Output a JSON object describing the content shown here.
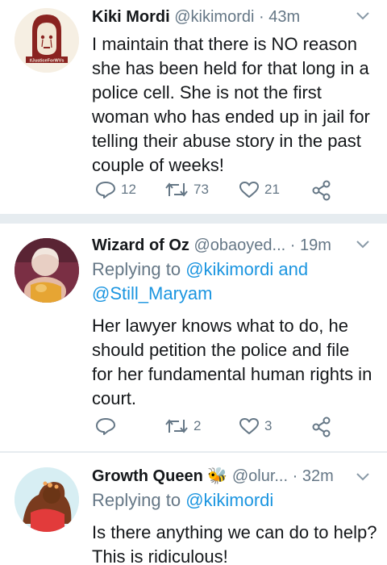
{
  "tweets": [
    {
      "name": "Kiki Mordi",
      "handle": "@kikimordi",
      "dot": "·",
      "time": "43m",
      "replying_prefix": "",
      "replying_mentions": "",
      "body_lines": [
        "I maintain that there is NO reason",
        "she has been held for that long in a",
        "police cell. She is not the first",
        "woman who has ended up in jail for",
        "telling their abuse story in the past",
        "couple of weeks!"
      ],
      "avatar_text": "#JusticeForWVs",
      "replies": "12",
      "retweets": "73",
      "likes": "21"
    },
    {
      "name": "Wizard of Oz",
      "handle": "@obaoyed...",
      "dot": "·",
      "time": "19m",
      "replying_lines": [
        "Replying to ",
        "@kikimordi and",
        "@Still_Maryam"
      ],
      "body_lines": [
        "Her lawyer knows what to do, he",
        "should petition the police and file",
        "for her fundamental human rights in",
        "court."
      ],
      "replies": "",
      "retweets": "2",
      "likes": "3"
    },
    {
      "name": "Growth Queen",
      "badge": "🐝",
      "handle": "@olur...",
      "dot": "·",
      "time": "32m",
      "replying_prefix": "Replying to ",
      "replying_mention": "@kikimordi",
      "body_lines": [
        "Is there anything we can do to help?",
        "This is ridiculous!"
      ]
    }
  ],
  "colors": {
    "text": "#14171a",
    "muted": "#657786",
    "link": "#1b95e0",
    "separator": "#e6ecf0"
  },
  "icons": [
    "reply-icon",
    "retweet-icon",
    "like-icon",
    "share-icon",
    "chevron-down-icon"
  ]
}
